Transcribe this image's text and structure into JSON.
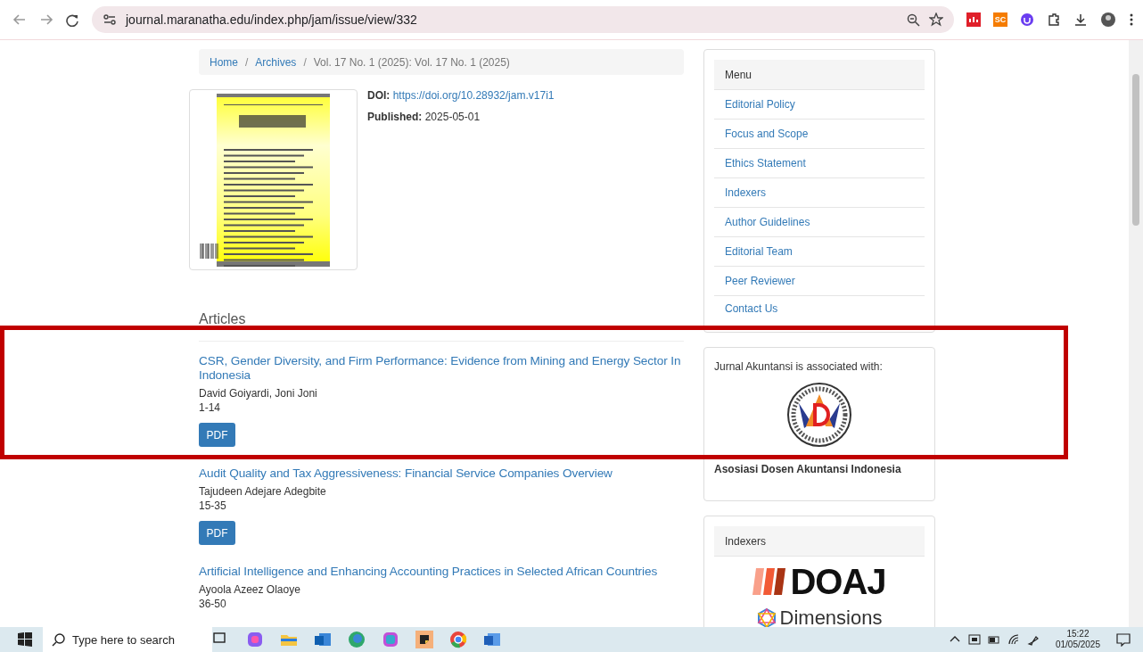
{
  "browser": {
    "url": "journal.maranatha.edu/index.php/jam/issue/view/332",
    "extension_badge": "SC"
  },
  "breadcrumb": [
    {
      "label": "Home",
      "link": true,
      "separator": "/"
    },
    {
      "label": "Archives",
      "link": true,
      "separator": "/"
    },
    {
      "label": "Vol. 17 No. 1 (2025): Vol. 17 No. 1 (2025)",
      "link": false
    }
  ],
  "issue": {
    "doi_label": "DOI:",
    "doi": "https://doi.org/10.28932/jam.v17i1",
    "published_label": "Published:",
    "published": "2025-05-01"
  },
  "articles_heading": "Articles",
  "articles": [
    {
      "title": "CSR, Gender Diversity, and Firm Performance: Evidence from Mining and Energy Sector In Indonesia",
      "authors": "David Goiyardi, Joni Joni",
      "pages": "1-14",
      "button": "PDF"
    },
    {
      "title": "Audit Quality and Tax Aggressiveness: Financial Service Companies Overview",
      "authors": "Tajudeen Adejare Adegbite",
      "pages": "15-35",
      "button": "PDF"
    },
    {
      "title": "Artificial Intelligence and Enhancing Accounting Practices in Selected African Countries",
      "authors": "Ayoola Azeez Olaoye",
      "pages": "36-50"
    }
  ],
  "sidebar": {
    "menu_title": "Menu",
    "menu": [
      "Editorial Policy",
      "Focus and Scope",
      "Ethics Statement",
      "Indexers",
      "Author Guidelines",
      "Editorial Team",
      "Peer Reviewer",
      "Contact Us"
    ],
    "association_intro": "Jurnal Akuntansi is associated with:",
    "association_name": "Asosiasi Dosen Akuntansi Indonesia",
    "indexers_title": "Indexers",
    "indexers": [
      {
        "name": "DOAJ",
        "kind": "doaj"
      },
      {
        "name": "Dimensions",
        "kind": "dimensions"
      }
    ]
  },
  "taskbar": {
    "search_placeholder": "Type here to search",
    "time": "15:22",
    "date": "01/05/2025"
  }
}
